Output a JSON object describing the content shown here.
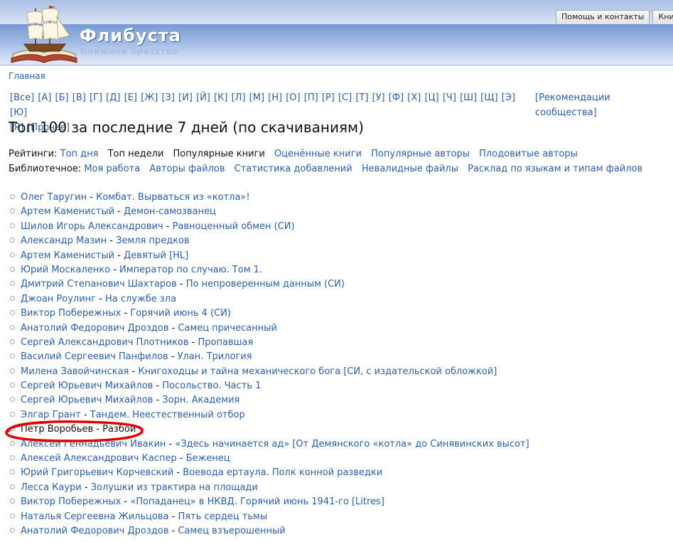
{
  "site": {
    "title": "Флибуста",
    "slogan": "Книжное братство"
  },
  "top_tabs": [
    "Помощь и контакты",
    "Книг"
  ],
  "breadcrumb": "Главная",
  "alphabet": [
    "[Все]",
    "[А]",
    "[Б]",
    "[В]",
    "[Г]",
    "[Д]",
    "[Е]",
    "[Ж]",
    "[З]",
    "[И]",
    "[Й]",
    "[К]",
    "[Л]",
    "[М]",
    "[Н]",
    "[О]",
    "[П]",
    "[Р]",
    "[С]",
    "[Т]",
    "[У]",
    "[Ф]",
    "[Х]",
    "[Ц]",
    "[Ч]",
    "[Ш]",
    "[Щ]",
    "[Э]",
    "[Ю]",
    "[Я]",
    "[Прочее]"
  ],
  "recommendations": "[Рекомендации сообщества]",
  "page_title": "Топ 100 за последние 7 дней (по скачиваниям)",
  "ratings": {
    "label": "Рейтинги:",
    "items": [
      {
        "text": "Топ дня",
        "link": true
      },
      {
        "text": "Топ недели",
        "link": false
      },
      {
        "text": "Популярные книги",
        "link": false
      },
      {
        "text": "Оценённые книги",
        "link": true
      },
      {
        "text": "Популярные авторы",
        "link": true
      },
      {
        "text": "Плодовитые авторы",
        "link": true
      }
    ]
  },
  "library": {
    "label": "Библиотечное:",
    "items": [
      {
        "text": "Моя работа"
      },
      {
        "text": "Авторы файлов"
      },
      {
        "text": "Статистика добавлений"
      },
      {
        "text": "Невалидные файлы"
      },
      {
        "text": "Расклад по языкам и типам файлов"
      }
    ]
  },
  "separator": " - ",
  "books": [
    {
      "author": "Олег Таругин",
      "title": "Комбат. Вырваться из «котла»!"
    },
    {
      "author": "Артем Каменистый",
      "title": "Демон-самозванец"
    },
    {
      "author": "Шилов Игорь Александрович",
      "title": "Равноценный обмен (СИ)"
    },
    {
      "author": "Александр Мазин",
      "title": "Земля предков"
    },
    {
      "author": "Артем Каменистый",
      "title": "Девятый [HL]"
    },
    {
      "author": "Юрий Москаленко",
      "title": "Император по случаю. Том 1."
    },
    {
      "author": "Дмитрий Степанович Шахтаров",
      "title": "По непроверенным данным (СИ)"
    },
    {
      "author": "Джоан Роулинг",
      "title": "На службе зла"
    },
    {
      "author": "Виктор Побережных",
      "title": "Горячий июнь 4 (СИ)"
    },
    {
      "author": "Анатолий Федорович Дроздов",
      "title": "Самец причесанный"
    },
    {
      "author": "Сергей Александрович Плотников",
      "title": "Пропавшая"
    },
    {
      "author": "Василий Сергеевич Панфилов",
      "title": "Улан. Трилогия"
    },
    {
      "author": "Милена Завойчинская",
      "title": "Книгоходцы и тайна механического бога [СИ, с издательской обложкой]"
    },
    {
      "author": "Сергей Юрьевич Михайлов",
      "title": "Посольство. Часть 1"
    },
    {
      "author": "Сергей Юрьевич Михайлов",
      "title": "Зорн. Академия"
    },
    {
      "author": "Элгар Грант",
      "title": "Тандем. Неестественный отбор"
    },
    {
      "author": "Петр Воробьев",
      "title": "Разбой",
      "highlighted": true
    },
    {
      "author": "Алексей Геннадьевич Ивакин",
      "title": "«Здесь начинается ад» [От Демянского «котла» до Синявинских высот]"
    },
    {
      "author": "Алексей Александрович Каспер",
      "title": "Беженец"
    },
    {
      "author": "Юрий Григорьевич Корчевский",
      "title": "Воевода ертаула. Полк конной разведки"
    },
    {
      "author": "Лесса Каури",
      "title": "Золушки из трактира на площади"
    },
    {
      "author": "Виктор Побережных",
      "title": "«Попаданец» в НКВД. Горячий июнь 1941-го [Litres]"
    },
    {
      "author": "Наталья Сергеевна Жильцова",
      "title": "Пять сердец тьмы"
    },
    {
      "author": "Анатолий Федорович Дроздов",
      "title": "Самец взъерошенный"
    }
  ],
  "colors": {
    "link": "#2d5fa3",
    "highlight_ring": "#e00000",
    "header_dark": "#4a72b6"
  },
  "icons": {
    "logo": "ship-on-book-icon",
    "bullet": "circle-bullet-icon"
  }
}
